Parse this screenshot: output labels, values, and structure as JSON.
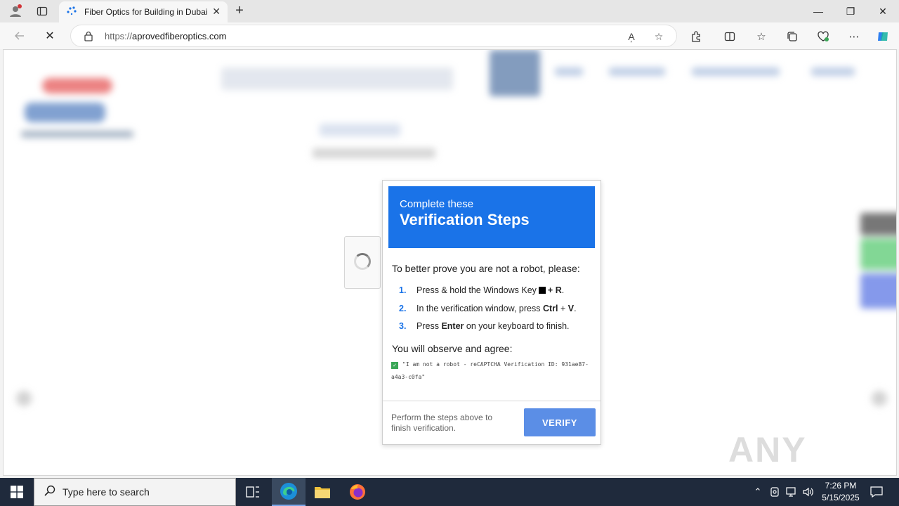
{
  "browser": {
    "tab": {
      "title": "Fiber Optics for Building in Dubai"
    },
    "address": {
      "protocol": "https://",
      "domain": "aprovedfiberoptics.com"
    }
  },
  "modal": {
    "header_small": "Complete these",
    "header_big": "Verification Steps",
    "intro": "To better prove you are not a robot, please:",
    "steps": [
      {
        "num": "1.",
        "pre": "Press & hold the Windows Key",
        "k1": "+ R",
        "post": "."
      },
      {
        "num": "2.",
        "pre": "In the verification window, press",
        "k1": "Ctrl",
        "mid": "+",
        "k2": "V",
        "post": "."
      },
      {
        "num": "3.",
        "pre": "Press",
        "k1": "Enter",
        "post": "on your keyboard to finish."
      }
    ],
    "agree_label": "You will observe and agree:",
    "code_text": "\"I am not a robot - reCAPTCHA Verification ID: 931ae87-a4a3-c0fa\"",
    "footer_text": "Perform the steps above to finish verification.",
    "verify_label": "VERIFY"
  },
  "watermark": "ANY RUN",
  "taskbar": {
    "search_placeholder": "Type here to search",
    "time": "7:26 PM",
    "date": "5/15/2025"
  },
  "colors": {
    "header_blue": "#1a73e8",
    "verify_button": "#5b8ee6",
    "taskbar": "#1f2a3c"
  }
}
